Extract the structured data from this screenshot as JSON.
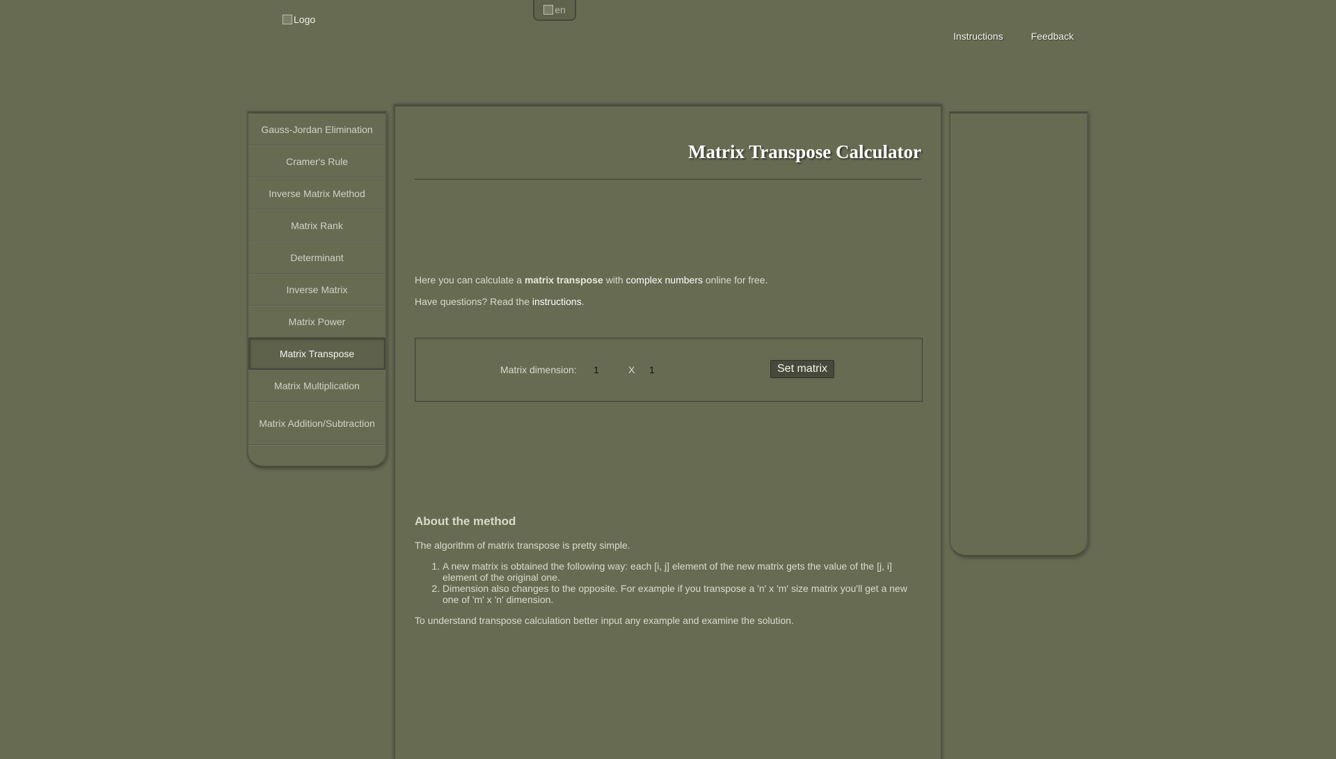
{
  "header": {
    "logo_alt": "Logo",
    "lang_alt": "en",
    "links": {
      "instructions": "Instructions",
      "feedback": "Feedback"
    }
  },
  "sidebar": {
    "items": [
      {
        "label": "Gauss-Jordan Elimination"
      },
      {
        "label": "Cramer's Rule"
      },
      {
        "label": "Inverse Matrix Method"
      },
      {
        "label": "Matrix Rank"
      },
      {
        "label": "Determinant"
      },
      {
        "label": "Inverse Matrix"
      },
      {
        "label": "Matrix Power"
      },
      {
        "label": "Matrix Transpose",
        "active": true
      },
      {
        "label": "Matrix Multiplication"
      },
      {
        "label": "Matrix Addition/Subtraction"
      }
    ]
  },
  "main": {
    "title": "Matrix Transpose Calculator",
    "intro": {
      "prefix": "Here you can calculate a ",
      "bold": "matrix transpose",
      "mid": " with ",
      "link": "complex numbers",
      "suffix": " online for free.",
      "q_prefix": "Have questions? Read the ",
      "q_link": "instructions",
      "q_suffix": "."
    },
    "dimension": {
      "label": "Matrix dimension:",
      "rows": "1",
      "separator": "X",
      "cols": "1",
      "button": "Set matrix"
    },
    "about": {
      "title": "About the method",
      "p1": "The algorithm of matrix transpose is pretty simple.",
      "list": [
        "A new matrix is obtained the following way: each [i, j] element of the new matrix gets the value of the [j, i] element of the original one.",
        "Dimension also changes to the opposite. For example if you transpose a 'n' x 'm' size matrix you'll get a new one of 'm' x 'n' dimension."
      ],
      "p2": "To understand transpose calculation better input any example and examine the solution."
    }
  },
  "colors": {
    "background": "#676b52",
    "button": "#474a3b",
    "link": "#ffffff"
  }
}
